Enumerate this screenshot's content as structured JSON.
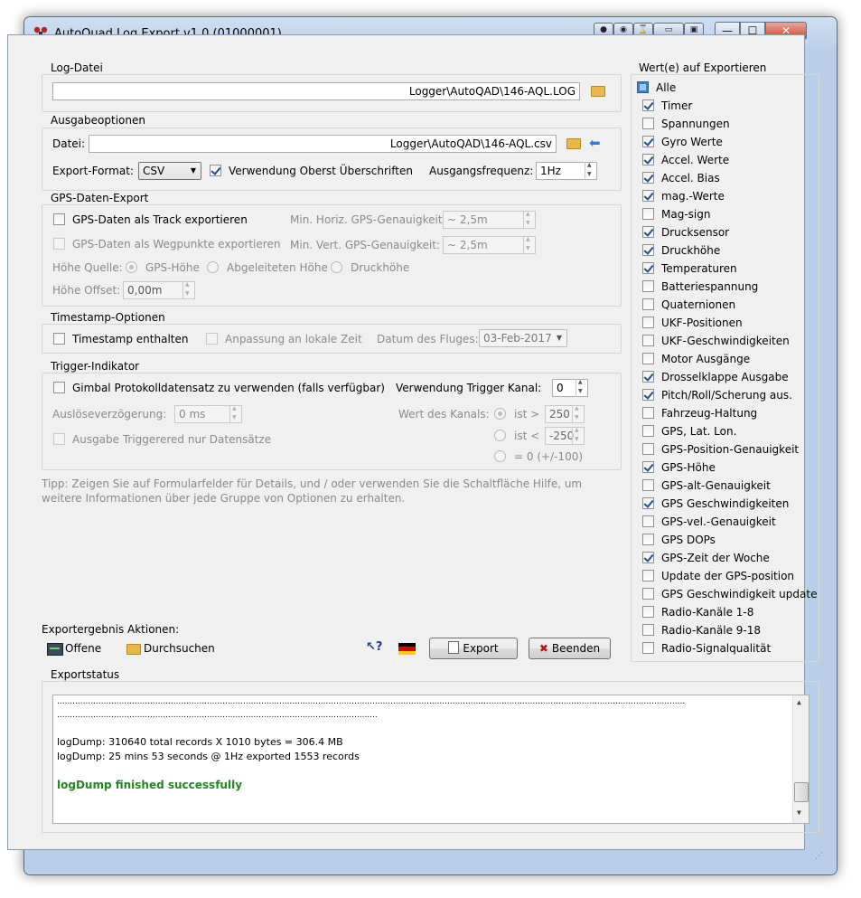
{
  "window": {
    "title": "AutoQuad Log Export v1.0 (01000001)"
  },
  "toolbar": {
    "min": "—",
    "max": "☐",
    "close": "✕"
  },
  "log": {
    "group": "Log-Datei",
    "path": "Logger\\AutoQAD\\146-AQL.LOG"
  },
  "output": {
    "group": "Ausgabeoptionen",
    "file_label": "Datei:",
    "file_path": "Logger\\AutoQAD\\146-AQL.csv",
    "format_label": "Export-Format:",
    "format_value": "CSV",
    "headers_label": "Verwendung Oberst Überschriften",
    "freq_label": "Ausgangsfrequenz:",
    "freq_value": "1Hz"
  },
  "gps": {
    "group": "GPS-Daten-Export",
    "track_label": "GPS-Daten als Track exportieren",
    "waypoints_label": "GPS-Daten als Wegpunkte exportieren",
    "horiz_label": "Min. Horiz. GPS-Genauigkeit:",
    "horiz_value": "~ 2,5m",
    "vert_label": "Min. Vert. GPS-Genauigkeit:",
    "vert_value": "~ 2,5m",
    "height_source_label": "Höhe Quelle:",
    "src_gps": "GPS-Höhe",
    "src_derived": "Abgeleiteten Höhe",
    "src_pressure": "Druckhöhe",
    "offset_label": "Höhe Offset:",
    "offset_value": "0,00m"
  },
  "timestamp": {
    "group": "Timestamp-Optionen",
    "include_label": "Timestamp enthalten",
    "local_label": "Anpassung an lokale Zeit",
    "date_label": "Datum des Fluges:",
    "date_value": "03-Feb-2017"
  },
  "trigger": {
    "group": "Trigger-Indikator",
    "gimbal_label": "Gimbal Protokolldatensatz zu verwenden (falls verfügbar)",
    "channel_label": "Verwendung Trigger Kanal:",
    "channel_value": "0",
    "delay_label": "Auslöseverzögerung:",
    "delay_value": "0 ms",
    "value_label": "Wert des Kanals:",
    "gt_label": "ist >",
    "gt_value": "250",
    "lt_label": "ist <",
    "lt_value": "-250",
    "eq_label": "= 0 (+/-100)",
    "only_label": "Ausgabe Triggerered nur Datensätze"
  },
  "tip": "Tipp: Zeigen Sie auf Formularfelder für Details, und / oder verwenden Sie die Schaltfläche Hilfe, um weitere Informationen über jede Gruppe von Optionen zu erhalten.",
  "actions": {
    "label": "Exportergebnis Aktionen:",
    "open": "Offene",
    "browse": "Durchsuchen",
    "export": "Export",
    "quit": "Beenden"
  },
  "values": {
    "group": "Wert(e) auf Exportieren",
    "all_label": "Alle",
    "items": [
      {
        "label": "Timer",
        "checked": true
      },
      {
        "label": "Spannungen",
        "checked": false
      },
      {
        "label": "Gyro Werte",
        "checked": true
      },
      {
        "label": "Accel. Werte",
        "checked": true
      },
      {
        "label": "Accel. Bias",
        "checked": true
      },
      {
        "label": "mag.-Werte",
        "checked": true
      },
      {
        "label": "Mag-sign",
        "checked": false
      },
      {
        "label": "Drucksensor",
        "checked": true
      },
      {
        "label": "Druckhöhe",
        "checked": true
      },
      {
        "label": "Temperaturen",
        "checked": true
      },
      {
        "label": "Batteriespannung",
        "checked": false
      },
      {
        "label": "Quaternionen",
        "checked": false
      },
      {
        "label": "UKF-Positionen",
        "checked": false
      },
      {
        "label": "UKF-Geschwindigkeiten",
        "checked": false
      },
      {
        "label": "Motor Ausgänge",
        "checked": false
      },
      {
        "label": "Drosselklappe Ausgabe",
        "checked": true
      },
      {
        "label": "Pitch/Roll/Scherung aus.",
        "checked": true
      },
      {
        "label": "Fahrzeug-Haltung",
        "checked": false
      },
      {
        "label": "GPS, Lat.  Lon.",
        "checked": false
      },
      {
        "label": "GPS-Position-Genauigkeit",
        "checked": false
      },
      {
        "label": "GPS-Höhe",
        "checked": true
      },
      {
        "label": "GPS-alt-Genauigkeit",
        "checked": false
      },
      {
        "label": "GPS Geschwindigkeiten",
        "checked": true
      },
      {
        "label": "GPS-vel.-Genauigkeit",
        "checked": false
      },
      {
        "label": "GPS DOPs",
        "checked": false
      },
      {
        "label": "GPS-Zeit der Woche",
        "checked": true
      },
      {
        "label": "Update der GPS-position",
        "checked": false
      },
      {
        "label": "GPS Geschwindigkeit update",
        "checked": false
      },
      {
        "label": "Radio-Kanäle 1-8",
        "checked": false
      },
      {
        "label": "Radio-Kanäle 9-18",
        "checked": false
      },
      {
        "label": "Radio-Signalqualität",
        "checked": false
      }
    ]
  },
  "export_status": {
    "group": "Exportstatus",
    "dots1": "...................................................................................................................................................................................................................................................",
    "dots2": "............................................................................................................................",
    "line1": "logDump: 310640 total records X 1010 bytes = 306.4 MB",
    "line2": "logDump: 25 mins 53 seconds @ 1Hz exported 1553 records",
    "success": "logDump finished successfully"
  },
  "colors": {
    "success": "#1f8a1f",
    "accent": "#3c82c6"
  }
}
